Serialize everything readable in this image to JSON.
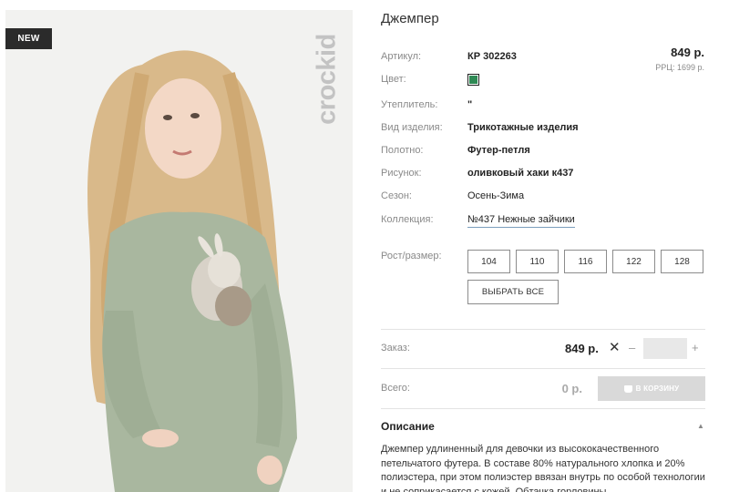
{
  "product": {
    "badge": "NEW",
    "brand": "crockid",
    "title": "Джемпер",
    "price": "849 р.",
    "rrp": "РРЦ: 1699 р."
  },
  "attributes": {
    "article": {
      "label": "Артикул:",
      "value": "КР 302263"
    },
    "color": {
      "label": "Цвет:",
      "swatch": "#2f8a55"
    },
    "insulation": {
      "label": "Утеплитель:",
      "value": "\""
    },
    "type": {
      "label": "Вид изделия:",
      "value": "Трикотажные изделия"
    },
    "fabric": {
      "label": "Полотно:",
      "value": "Футер-петля"
    },
    "pattern": {
      "label": "Рисунок:",
      "value": "оливковый хаки к437"
    },
    "season": {
      "label": "Сезон:",
      "value": "Осень-Зима"
    },
    "collection": {
      "label": "Коллекция:",
      "value": "№437 Нежные зайчики"
    }
  },
  "sizes": {
    "label": "Рост/размер:",
    "options": [
      "104",
      "110",
      "116",
      "122",
      "128"
    ],
    "select_all": "ВЫБРАТЬ ВСЕ"
  },
  "order": {
    "label": "Заказ:",
    "price": "849 р.",
    "remove": "✕",
    "minus": "–",
    "plus": "+",
    "quantity": ""
  },
  "total": {
    "label": "Всего:",
    "value": "0 р.",
    "cart_button": "В КОРЗИНУ"
  },
  "description": {
    "title": "Описание",
    "caret": "▲",
    "text": "Джемпер удлиненный для девочки из высококачественного петельчатого футера. В составе 80% натурального хлопка и 20% полиэстера, при этом полиэстер ввязан внутрь по особой технологии и не соприкасается с кожей. Обтачка горловины,"
  },
  "colors": {
    "accent_link": "#7a9ebd",
    "cart_button_bg": "#d9d9d9",
    "badge_bg": "#2b2b2b"
  }
}
